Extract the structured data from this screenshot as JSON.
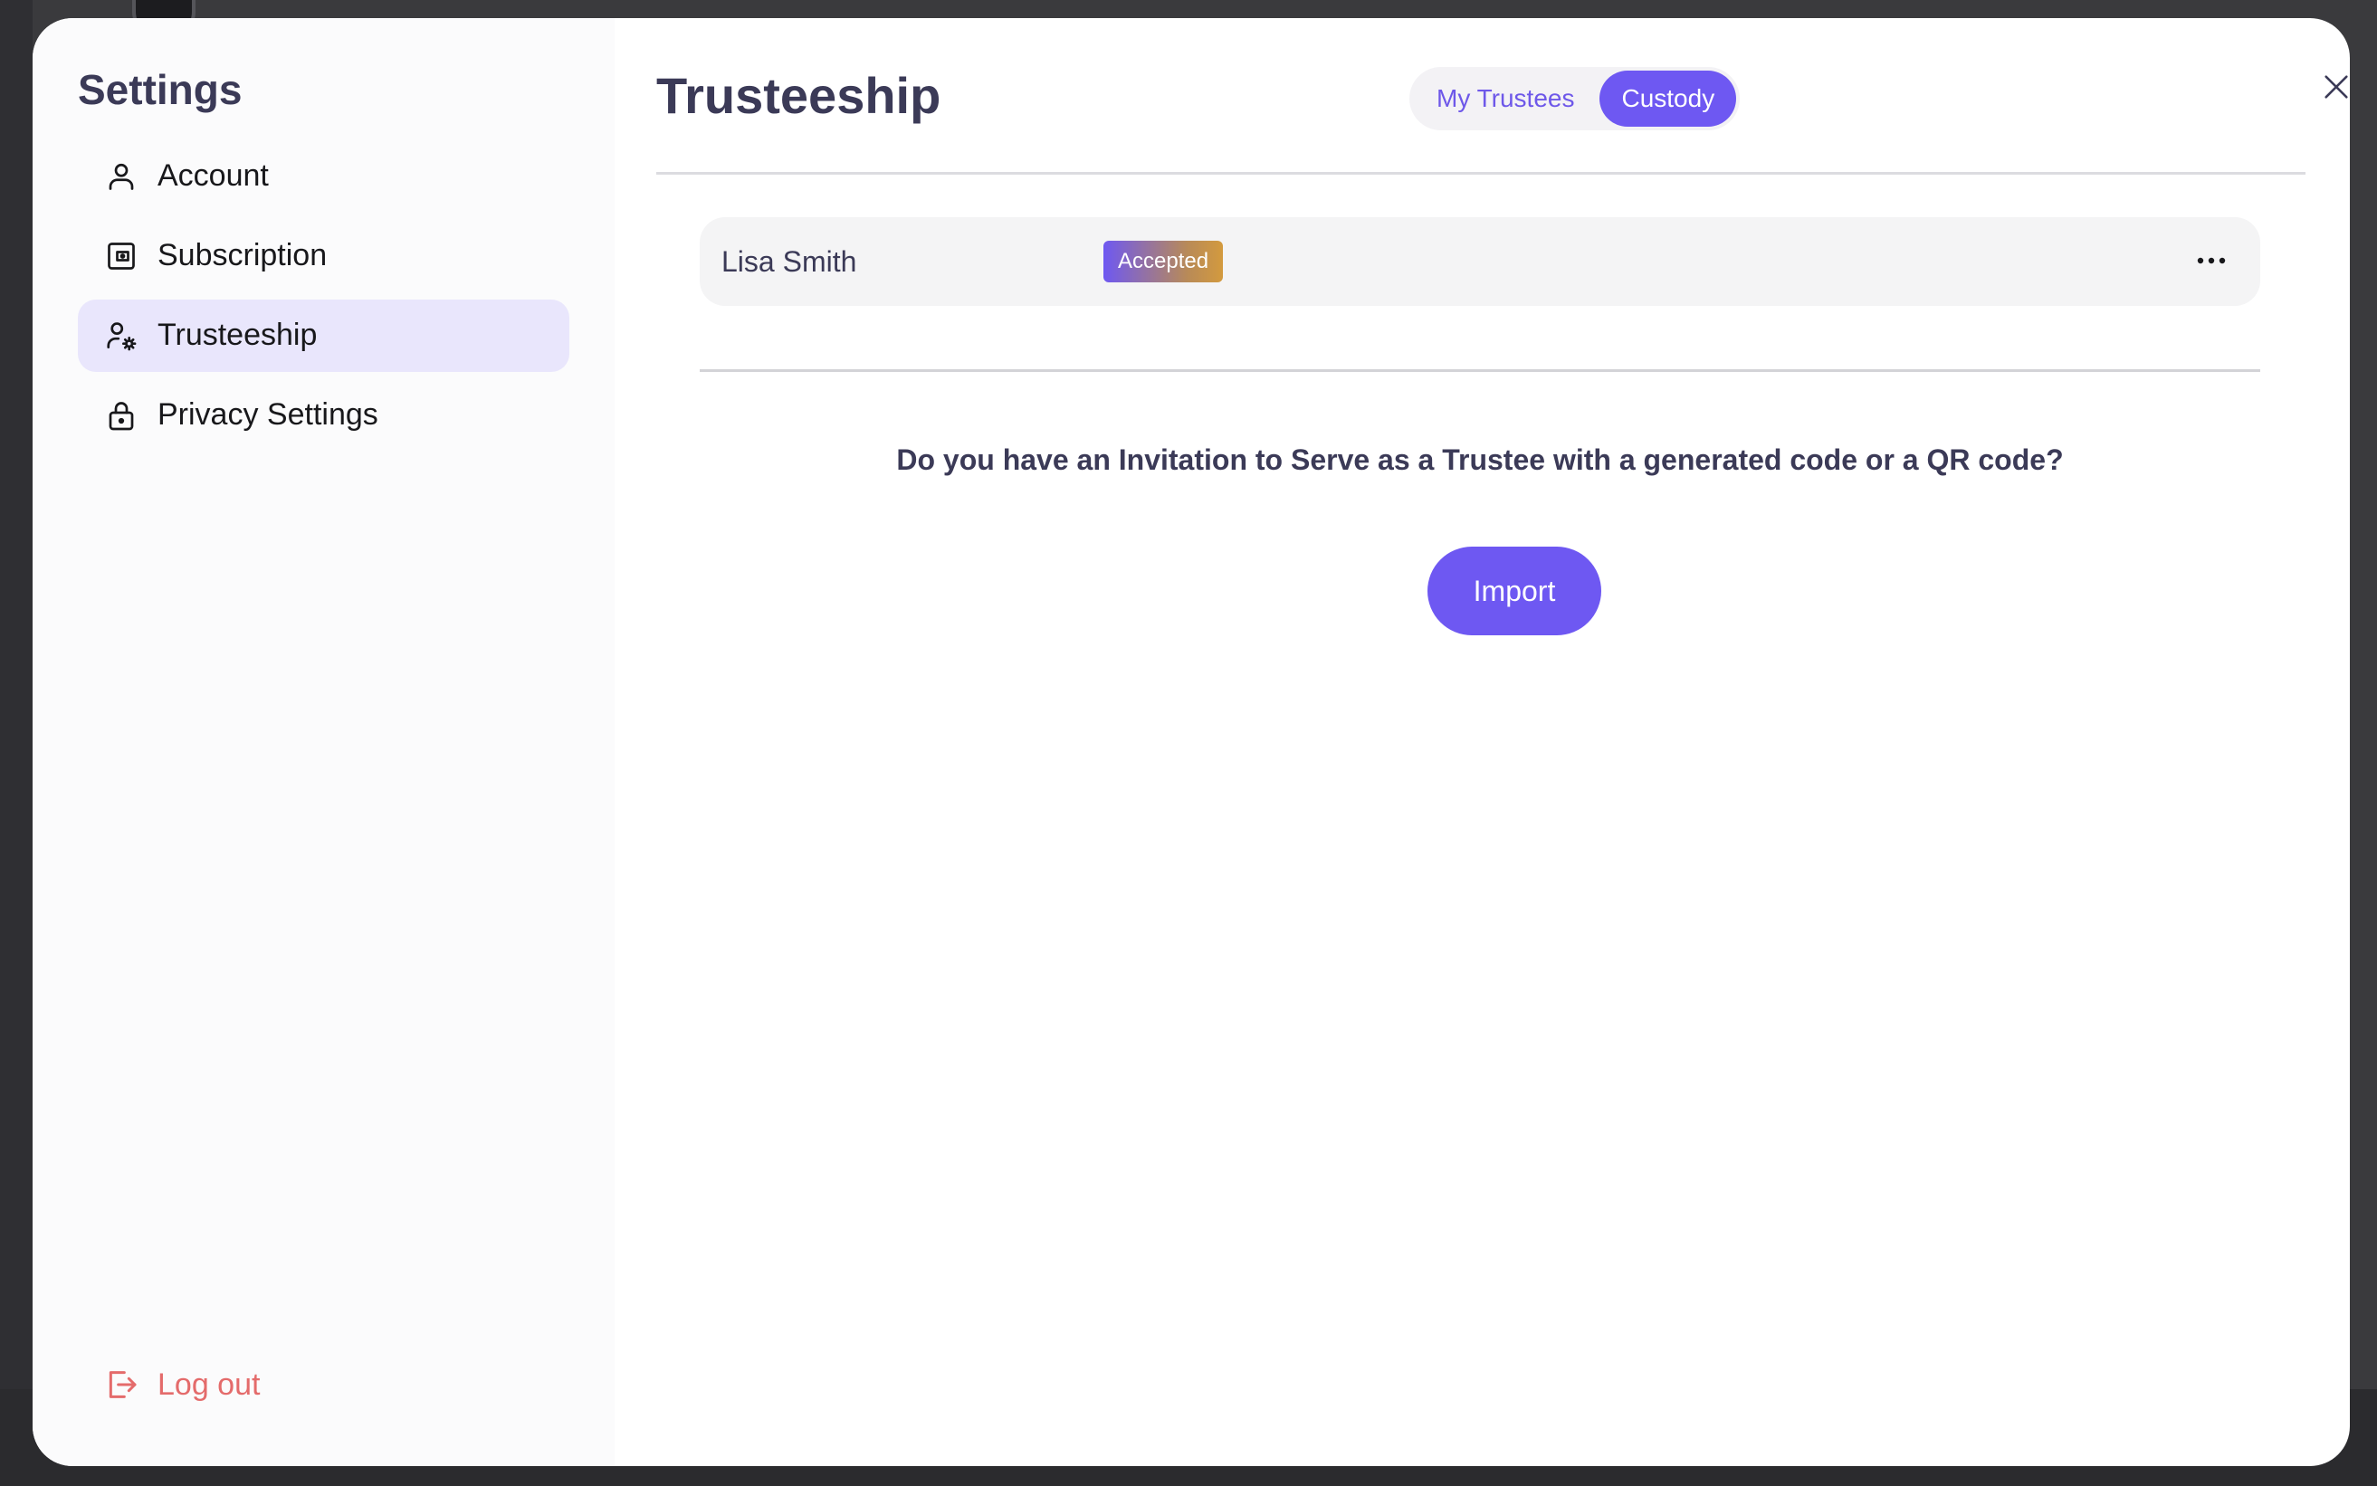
{
  "sidebar": {
    "title": "Settings",
    "items": [
      {
        "label": "Account",
        "icon": "user-icon"
      },
      {
        "label": "Subscription",
        "icon": "wallet-icon"
      },
      {
        "label": "Trusteeship",
        "icon": "user-gear-icon",
        "active": true
      },
      {
        "label": "Privacy Settings",
        "icon": "lock-icon"
      }
    ],
    "logout_label": "Log out"
  },
  "main": {
    "title": "Trusteeship",
    "tabs": [
      {
        "label": "My Trustees",
        "active": false
      },
      {
        "label": "Custody",
        "active": true
      }
    ],
    "trustees": [
      {
        "name": "Lisa Smith",
        "status": "Accepted"
      }
    ],
    "invite_question": "Do you have an Invitation to Serve as a Trustee with a generated code or a QR code?",
    "import_label": "Import"
  },
  "colors": {
    "accent": "#6e58f2",
    "active_nav_bg": "#e9e6fc",
    "logout": "#e46b6b",
    "title_text": "#3b3a57"
  }
}
